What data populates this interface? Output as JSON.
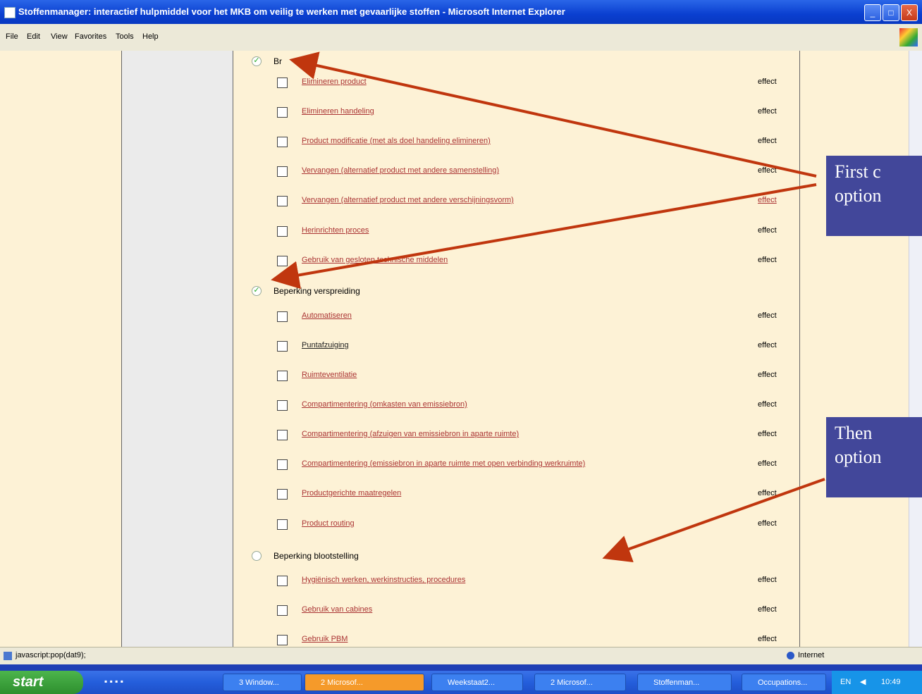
{
  "window": {
    "title": "Stoffenmanager: interactief hulpmiddel voor het MKB om veilig te werken met gevaarlijke stoffen - Microsoft Internet Explorer",
    "min": "_",
    "max": "□",
    "close": "X"
  },
  "menu": [
    "File",
    "Edit",
    "View",
    "Favorites",
    "Tools",
    "Help"
  ],
  "sections": [
    {
      "heading": "Br",
      "checked": true,
      "items": [
        {
          "label": "Elimineren product",
          "effect": "effect"
        },
        {
          "label": "Elimineren handeling",
          "effect": "effect"
        },
        {
          "label": "Product modificatie (met als doel handeling elimineren)",
          "effect": "effect"
        },
        {
          "label": "Vervangen (alternatief product met andere samenstelling)",
          "effect": "effect"
        },
        {
          "label": "Vervangen (alternatief product met andere verschijningsvorm)",
          "effect": "effect"
        },
        {
          "label": "Herinrichten proces",
          "effect": "effect"
        },
        {
          "label": "Gebruik van gesloten technische middelen",
          "effect": "effect"
        }
      ]
    },
    {
      "heading": "Beperking verspreiding",
      "checked": true,
      "items": [
        {
          "label": "Automatiseren",
          "effect": "effect"
        },
        {
          "label": "Puntafzuiging",
          "effect": "effect"
        },
        {
          "label": "Ruimteventilatie",
          "effect": "effect"
        },
        {
          "label": "Compartimentering (omkasten van emissiebron)",
          "effect": "effect"
        },
        {
          "label": "Compartimentering (afzuigen van emissiebron in aparte ruimte)",
          "effect": "effect"
        },
        {
          "label": "Compartimentering (emissiebron in aparte ruimte met open verbinding werkruimte)",
          "effect": "effect"
        },
        {
          "label": "Productgerichte maatregelen",
          "effect": "effect"
        },
        {
          "label": "Product routing",
          "effect": "effect"
        }
      ]
    },
    {
      "heading": "Beperking blootstelling",
      "checked": false,
      "items": [
        {
          "label": "Hygiënisch werken, werkinstructies, procedures",
          "effect": "effect"
        },
        {
          "label": "Gebruik van cabines",
          "effect": "effect"
        },
        {
          "label": "Gebruik PBM",
          "effect": "effect"
        }
      ]
    }
  ],
  "callouts": {
    "first": "First c\noption",
    "then": "Then \noption"
  },
  "status": {
    "text": "javascript:pop(dat9);",
    "zone": "Internet"
  },
  "taskbar": {
    "start": "start",
    "tasks": [
      "3 Window...",
      "2 Microsof...",
      "Weekstaat2...",
      "2 Microsof...",
      "Stoffenman...",
      "Occupations..."
    ],
    "tray_lang": "EN",
    "tray_time": "10:49"
  },
  "colors": {
    "link": "#aa3333",
    "arrow": "#c0360e",
    "callout": "#42479a",
    "page": "#fdf2d6"
  }
}
